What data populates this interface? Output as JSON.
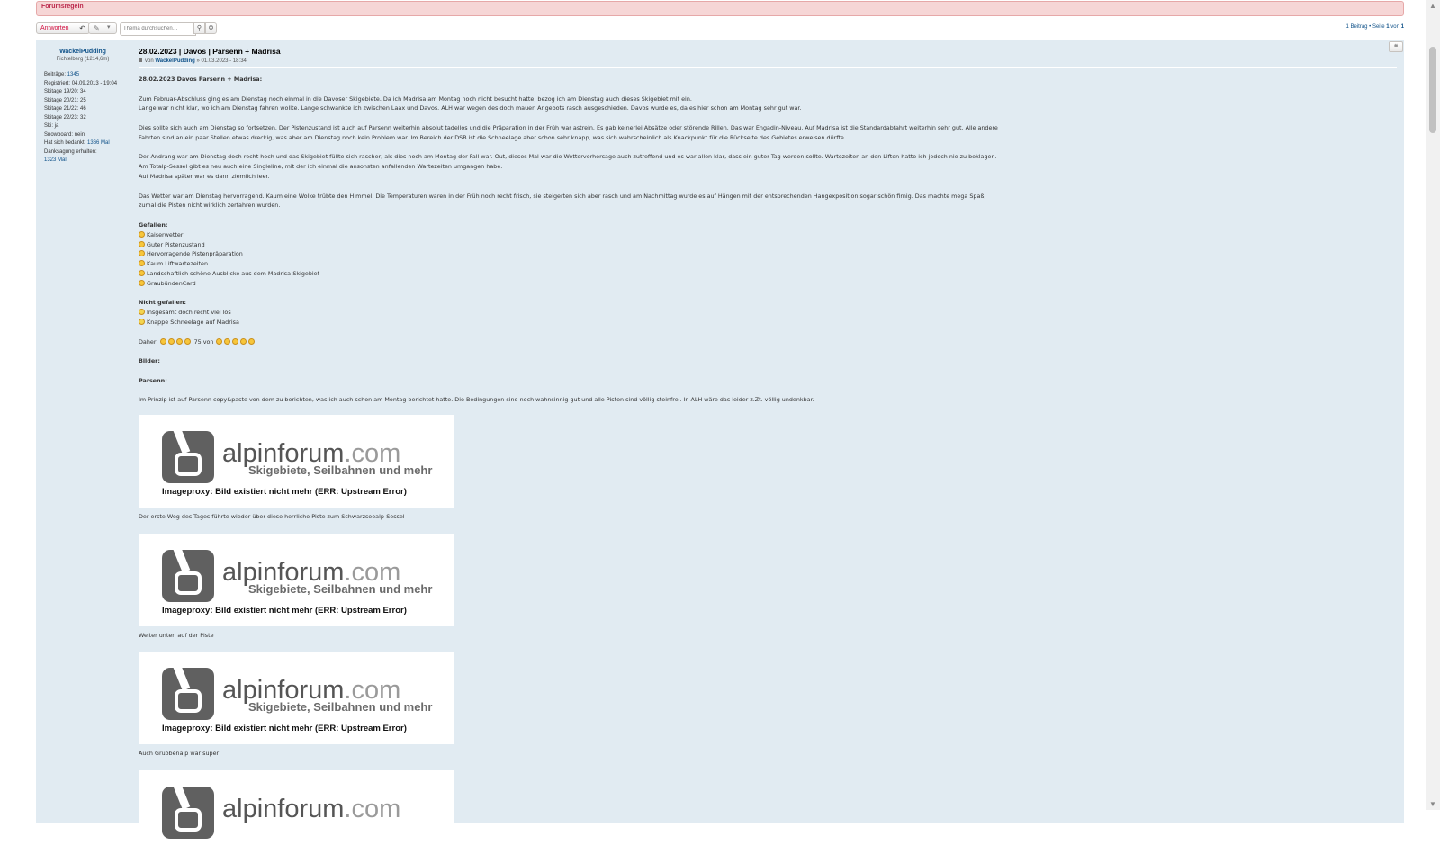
{
  "rules": {
    "label": "Forumsregeln"
  },
  "toolbar": {
    "reply_label": "Antworten",
    "reply_icon": "reply-arrow-icon",
    "tools_icon": "wrench-icon",
    "tools_caret": "chevron-down-icon",
    "search_placeholder": "Thema durchsuchen…",
    "search_icon": "search-icon",
    "advanced_icon": "gear-icon"
  },
  "pagination": {
    "count_text": "1 Beitrag • Seite ",
    "page": "1",
    "of_text": " von ",
    "total": "1"
  },
  "profile": {
    "username": "WackelPudding",
    "rank": "Fichtelberg (1214,6m)",
    "posts_label": "Beiträge:",
    "posts_value": "1345",
    "registered_label": "Registriert:",
    "registered_value": "04.09.2013 - 19:04",
    "ski_1920": "Skitage 19/20: 34",
    "ski_2021": "Skitage 20/21: 25",
    "ski_2122": "Skitage 21/22: 46",
    "ski_2223": "Skitage 22/23: 32",
    "ski": "Ski: ja",
    "snowboard": "Snowboard: nein",
    "thanked_label": "Hat sich bedankt:",
    "thanked_value": "1366 Mal",
    "thanks_received_label": "Danksagung erhalten:",
    "thanks_received_value": "1323 Mal"
  },
  "post": {
    "title": "28.02.2023 | Davos | Parsenn + Madrisa",
    "by": "von",
    "author": "WackelPudding",
    "date": "» 01.03.2023 - 18:34",
    "quote_icon": "quote-icon",
    "heading": "28.02.2023 Davos Parsenn + Madrisa:",
    "para1a": "Zum Februar-Abschluss ging es am Dienstag noch einmal in die Davoser Skigebiete. Da ich Madrisa am Montag noch nicht besucht hatte, bezog ich am Dienstag auch dieses Skigebiet mit ein.",
    "para1b": "Lange war nicht klar, wo ich am Dienstag fahren wollte. Lange schwankte ich zwischen Laax und Davos. ALH war wegen des doch mauen Angebots rasch ausgeschieden. Davos wurde es, da es hier schon am Montag sehr gut war.",
    "para2": "Dies sollte sich auch am Dienstag so fortsetzen. Der Pistenzustand ist auch auf Parsenn weiterhin absolut tadellos und die Präparation in der Früh war astrein. Es gab keinerlei Absätze oder störende Rillen. Das war Engadin-Niveau. Auf Madrisa ist die Standardabfahrt weiterhin sehr gut. Alle andere Fahrten sind an ein paar Stellen etwas dreckig, was aber am Dienstag noch kein Problem war. Im Bereich der DSB ist die Schneelage aber schon sehr knapp, was sich wahrscheinlich als Knackpunkt für die Rückseite des Gebietes erweisen dürfte.",
    "para3a": "Der Andrang war am Dienstag doch recht hoch und das Skigebiet füllte sich rascher, als dies noch am Montag der Fall war. Out, dieses Mal war die Wettervorhersage auch zutreffend und es war allen klar, dass ein guter Tag werden sollte. Wartezeiten an den Liften hatte ich jedoch nie zu beklagen. Am Totalp-Sessel gibt es neu auch eine Singleline, mit der ich einmal die ansonsten anfallenden Wartezeiten umgangen habe.",
    "para3b": "Auf Madrisa später war es dann ziemlich leer.",
    "para4": "Das Wetter war am Dienstag hervorragend. Kaum eine Wolke trübte den Himmel. Die Temperaturen waren in der Früh noch recht frisch, sie steigerten sich aber rasch und am Nachmittag wurde es auf Hängen mit der entsprechenden Hangexposition sogar schön firnig. Das machte mega Spaß, zumal die Pisten nicht wirklich zerfahren wurden.",
    "liked_heading": "Gefallen:",
    "liked": [
      "Kaiserwetter",
      "Guter Pistenzustand",
      "Hervorragende Pistenpräparation",
      "Kaum Liftwartezeiten",
      "Landschaftlich schöne Ausblicke aus dem Madrisa-Skigebiet",
      "GraubündenCard"
    ],
    "disliked_heading": "Nicht gefallen:",
    "disliked": [
      "Insgesamt doch recht viel los",
      "Knappe Schneelage auf Madrisa"
    ],
    "rating_prefix": "Daher:",
    "rating_mid": ",75 von",
    "pictures_heading": "Bilder:",
    "parsenn_heading": "Parsenn:",
    "parsenn_text": "Im Prinzip ist auf Parsenn copy&paste von dem zu berichten, was ich auch schon am Montag berichtet hatte. Die Bedingungen sind noch wahnsinnig gut und alle Pisten sind völlig steinfrei. In ALH wäre das leider z.Zt. völlig undenkbar.",
    "image": {
      "brand_main": "alpinforum",
      "brand_dot": ".com",
      "brand_sub": "Skigebiete, Seilbahnen und mehr",
      "error": "Imageproxy: Bild existiert nicht mehr (ERR: Upstream Error)"
    },
    "captions": [
      "Der erste Weg des Tages führte wieder über diese herrliche Piste zum Schwarzseealp-Sessel",
      "Weiter unten auf der Piste",
      "Auch Gruobenalp war super"
    ]
  },
  "scrollbar": {
    "up_icon": "scroll-up-icon",
    "down_icon": "scroll-down-icon"
  }
}
